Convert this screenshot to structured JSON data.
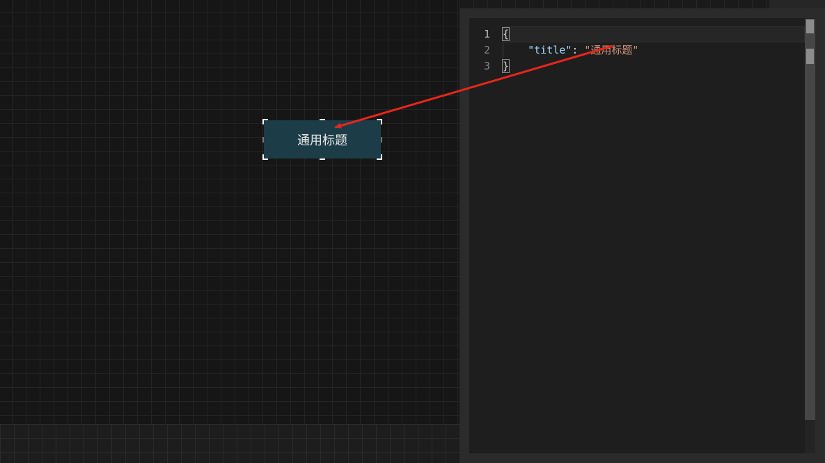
{
  "canvas": {
    "widget": {
      "label": "通用标题",
      "bg_color": "#1c3d47"
    }
  },
  "editor": {
    "lines": [
      {
        "number": "1",
        "text": "{"
      },
      {
        "number": "2",
        "key": "\"title\"",
        "colon": ": ",
        "value": "\"通用标题\""
      },
      {
        "number": "3",
        "text": "}"
      }
    ]
  },
  "colors": {
    "key": "#9cdcfe",
    "string": "#ce9178",
    "arrow": "#e8261b",
    "editor_bg": "#1e1e1e"
  }
}
